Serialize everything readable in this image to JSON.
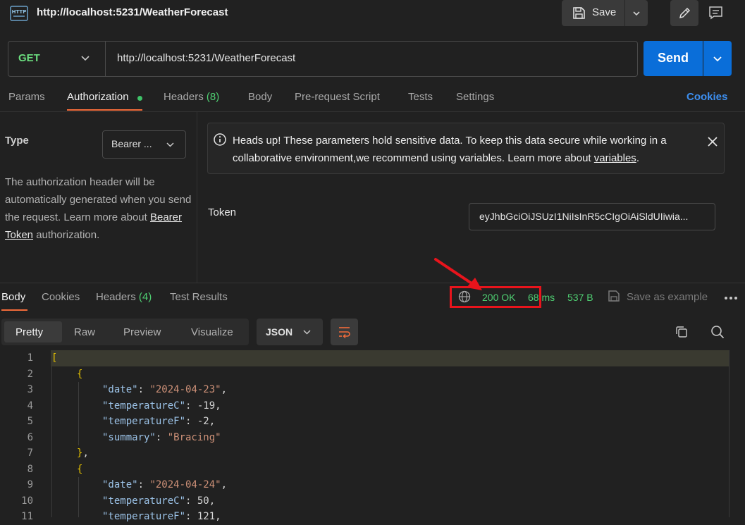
{
  "request": {
    "title": "http://localhost:5231/WeatherForecast",
    "save_label": "Save",
    "method": "GET",
    "url": "http://localhost:5231/WeatherForecast",
    "send_label": "Send"
  },
  "tabs": {
    "params": "Params",
    "authorization": "Authorization",
    "headers": "Headers",
    "headers_count": "(8)",
    "body": "Body",
    "prerequest": "Pre-request Script",
    "tests": "Tests",
    "settings": "Settings",
    "cookies": "Cookies"
  },
  "auth": {
    "type_label": "Type",
    "type_value": "Bearer ...",
    "desc_1": "The authorization header will be automatically generated when you send the request. Learn more about ",
    "desc_link": "Bearer Token",
    "desc_2": " authorization.",
    "alert_text": "Heads up! These parameters hold sensitive data. To keep this data secure while working in a collaborative environment,we recommend using variables. Learn more about ",
    "alert_link": "variables",
    "alert_end": ".",
    "token_label": "Token",
    "token_value": "eyJhbGciOiJSUzI1NiIsInR5cCIgOiAiSldUIiwia..."
  },
  "response": {
    "tabs": {
      "body": "Body",
      "cookies": "Cookies",
      "headers": "Headers",
      "headers_count": "(4)",
      "test_results": "Test Results"
    },
    "status": "200 OK",
    "time": "68",
    "time_unit": "ms",
    "size": "537 B",
    "save_example": "Save as example",
    "views": {
      "pretty": "Pretty",
      "raw": "Raw",
      "preview": "Preview",
      "visualize": "Visualize"
    },
    "format": "JSON"
  },
  "code_lines": [
    {
      "n": "1",
      "indent": 0,
      "parts": [
        [
          "brace",
          "["
        ]
      ]
    },
    {
      "n": "2",
      "indent": 1,
      "parts": [
        [
          "brace",
          "{"
        ]
      ]
    },
    {
      "n": "3",
      "indent": 2,
      "parts": [
        [
          "key",
          "\"date\""
        ],
        [
          "punc",
          ": "
        ],
        [
          "str",
          "\"2024-04-23\""
        ],
        [
          "punc",
          ","
        ]
      ]
    },
    {
      "n": "4",
      "indent": 2,
      "parts": [
        [
          "key",
          "\"temperatureC\""
        ],
        [
          "punc",
          ": "
        ],
        [
          "num",
          "-19"
        ],
        [
          "punc",
          ","
        ]
      ]
    },
    {
      "n": "5",
      "indent": 2,
      "parts": [
        [
          "key",
          "\"temperatureF\""
        ],
        [
          "punc",
          ": "
        ],
        [
          "num",
          "-2"
        ],
        [
          "punc",
          ","
        ]
      ]
    },
    {
      "n": "6",
      "indent": 2,
      "parts": [
        [
          "key",
          "\"summary\""
        ],
        [
          "punc",
          ": "
        ],
        [
          "str",
          "\"Bracing\""
        ]
      ]
    },
    {
      "n": "7",
      "indent": 1,
      "parts": [
        [
          "brace",
          "}"
        ],
        [
          "punc",
          ","
        ]
      ]
    },
    {
      "n": "8",
      "indent": 1,
      "parts": [
        [
          "brace",
          "{"
        ]
      ]
    },
    {
      "n": "9",
      "indent": 2,
      "parts": [
        [
          "key",
          "\"date\""
        ],
        [
          "punc",
          ": "
        ],
        [
          "str",
          "\"2024-04-24\""
        ],
        [
          "punc",
          ","
        ]
      ]
    },
    {
      "n": "10",
      "indent": 2,
      "parts": [
        [
          "key",
          "\"temperatureC\""
        ],
        [
          "punc",
          ": "
        ],
        [
          "num",
          "50"
        ],
        [
          "punc",
          ","
        ]
      ]
    },
    {
      "n": "11",
      "indent": 2,
      "parts": [
        [
          "key",
          "\"temperatureF\""
        ],
        [
          "punc",
          ": "
        ],
        [
          "num",
          "121"
        ],
        [
          "punc",
          ","
        ]
      ]
    }
  ]
}
